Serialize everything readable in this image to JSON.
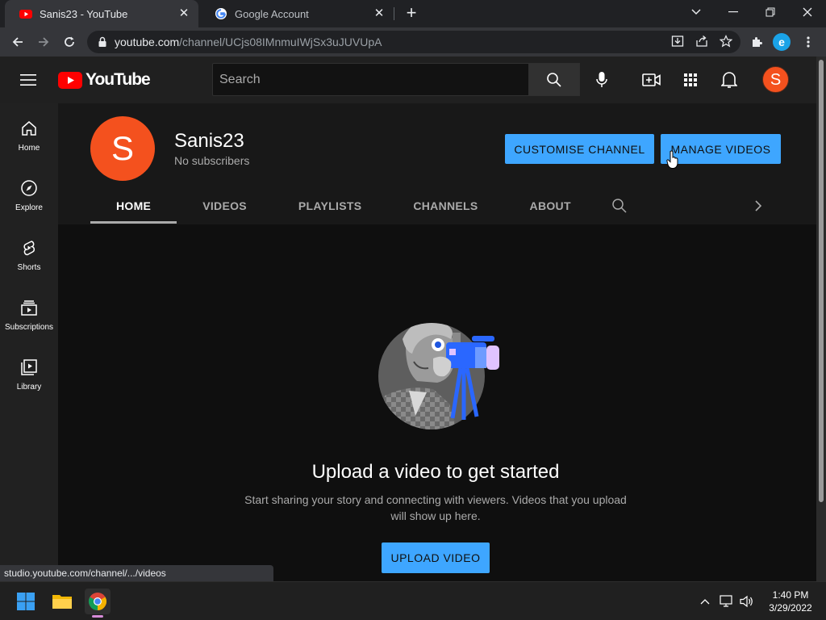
{
  "browser": {
    "tabs": [
      {
        "title": "Sanis23 - YouTube",
        "active": true
      },
      {
        "title": "Google Account",
        "active": false
      }
    ],
    "url_host": "youtube.com",
    "url_path": "/channel/UCjs08IMnmuIWjSx3uJUVUpA",
    "extension_letter": "e"
  },
  "masthead": {
    "logo_text": "YouTube",
    "search_placeholder": "Search",
    "avatar_letter": "S"
  },
  "guide": {
    "items": [
      {
        "label": "Home",
        "icon": "home-icon"
      },
      {
        "label": "Explore",
        "icon": "compass-icon"
      },
      {
        "label": "Shorts",
        "icon": "shorts-icon"
      },
      {
        "label": "Subscriptions",
        "icon": "subscriptions-icon"
      },
      {
        "label": "Library",
        "icon": "library-icon"
      }
    ]
  },
  "channel": {
    "avatar_letter": "S",
    "name": "Sanis23",
    "subscribers": "No subscribers",
    "customise_label": "CUSTOMISE CHANNEL",
    "manage_label": "MANAGE VIDEOS",
    "tabs": [
      {
        "label": "HOME",
        "active": true
      },
      {
        "label": "VIDEOS",
        "active": false
      },
      {
        "label": "PLAYLISTS",
        "active": false
      },
      {
        "label": "CHANNELS",
        "active": false
      },
      {
        "label": "ABOUT",
        "active": false
      }
    ]
  },
  "empty_state": {
    "title": "Upload a video to get started",
    "subtitle": "Start sharing your story and connecting with viewers. Videos that you upload will show up here.",
    "upload_label": "UPLOAD VIDEO"
  },
  "status_bar": {
    "url": "studio.youtube.com/channel/.../videos"
  },
  "taskbar": {
    "time": "1:40 PM",
    "date": "3/29/2022"
  },
  "colors": {
    "accent_blue": "#3ea6ff",
    "youtube_red": "#ff0000",
    "avatar_orange": "#f4511e"
  }
}
